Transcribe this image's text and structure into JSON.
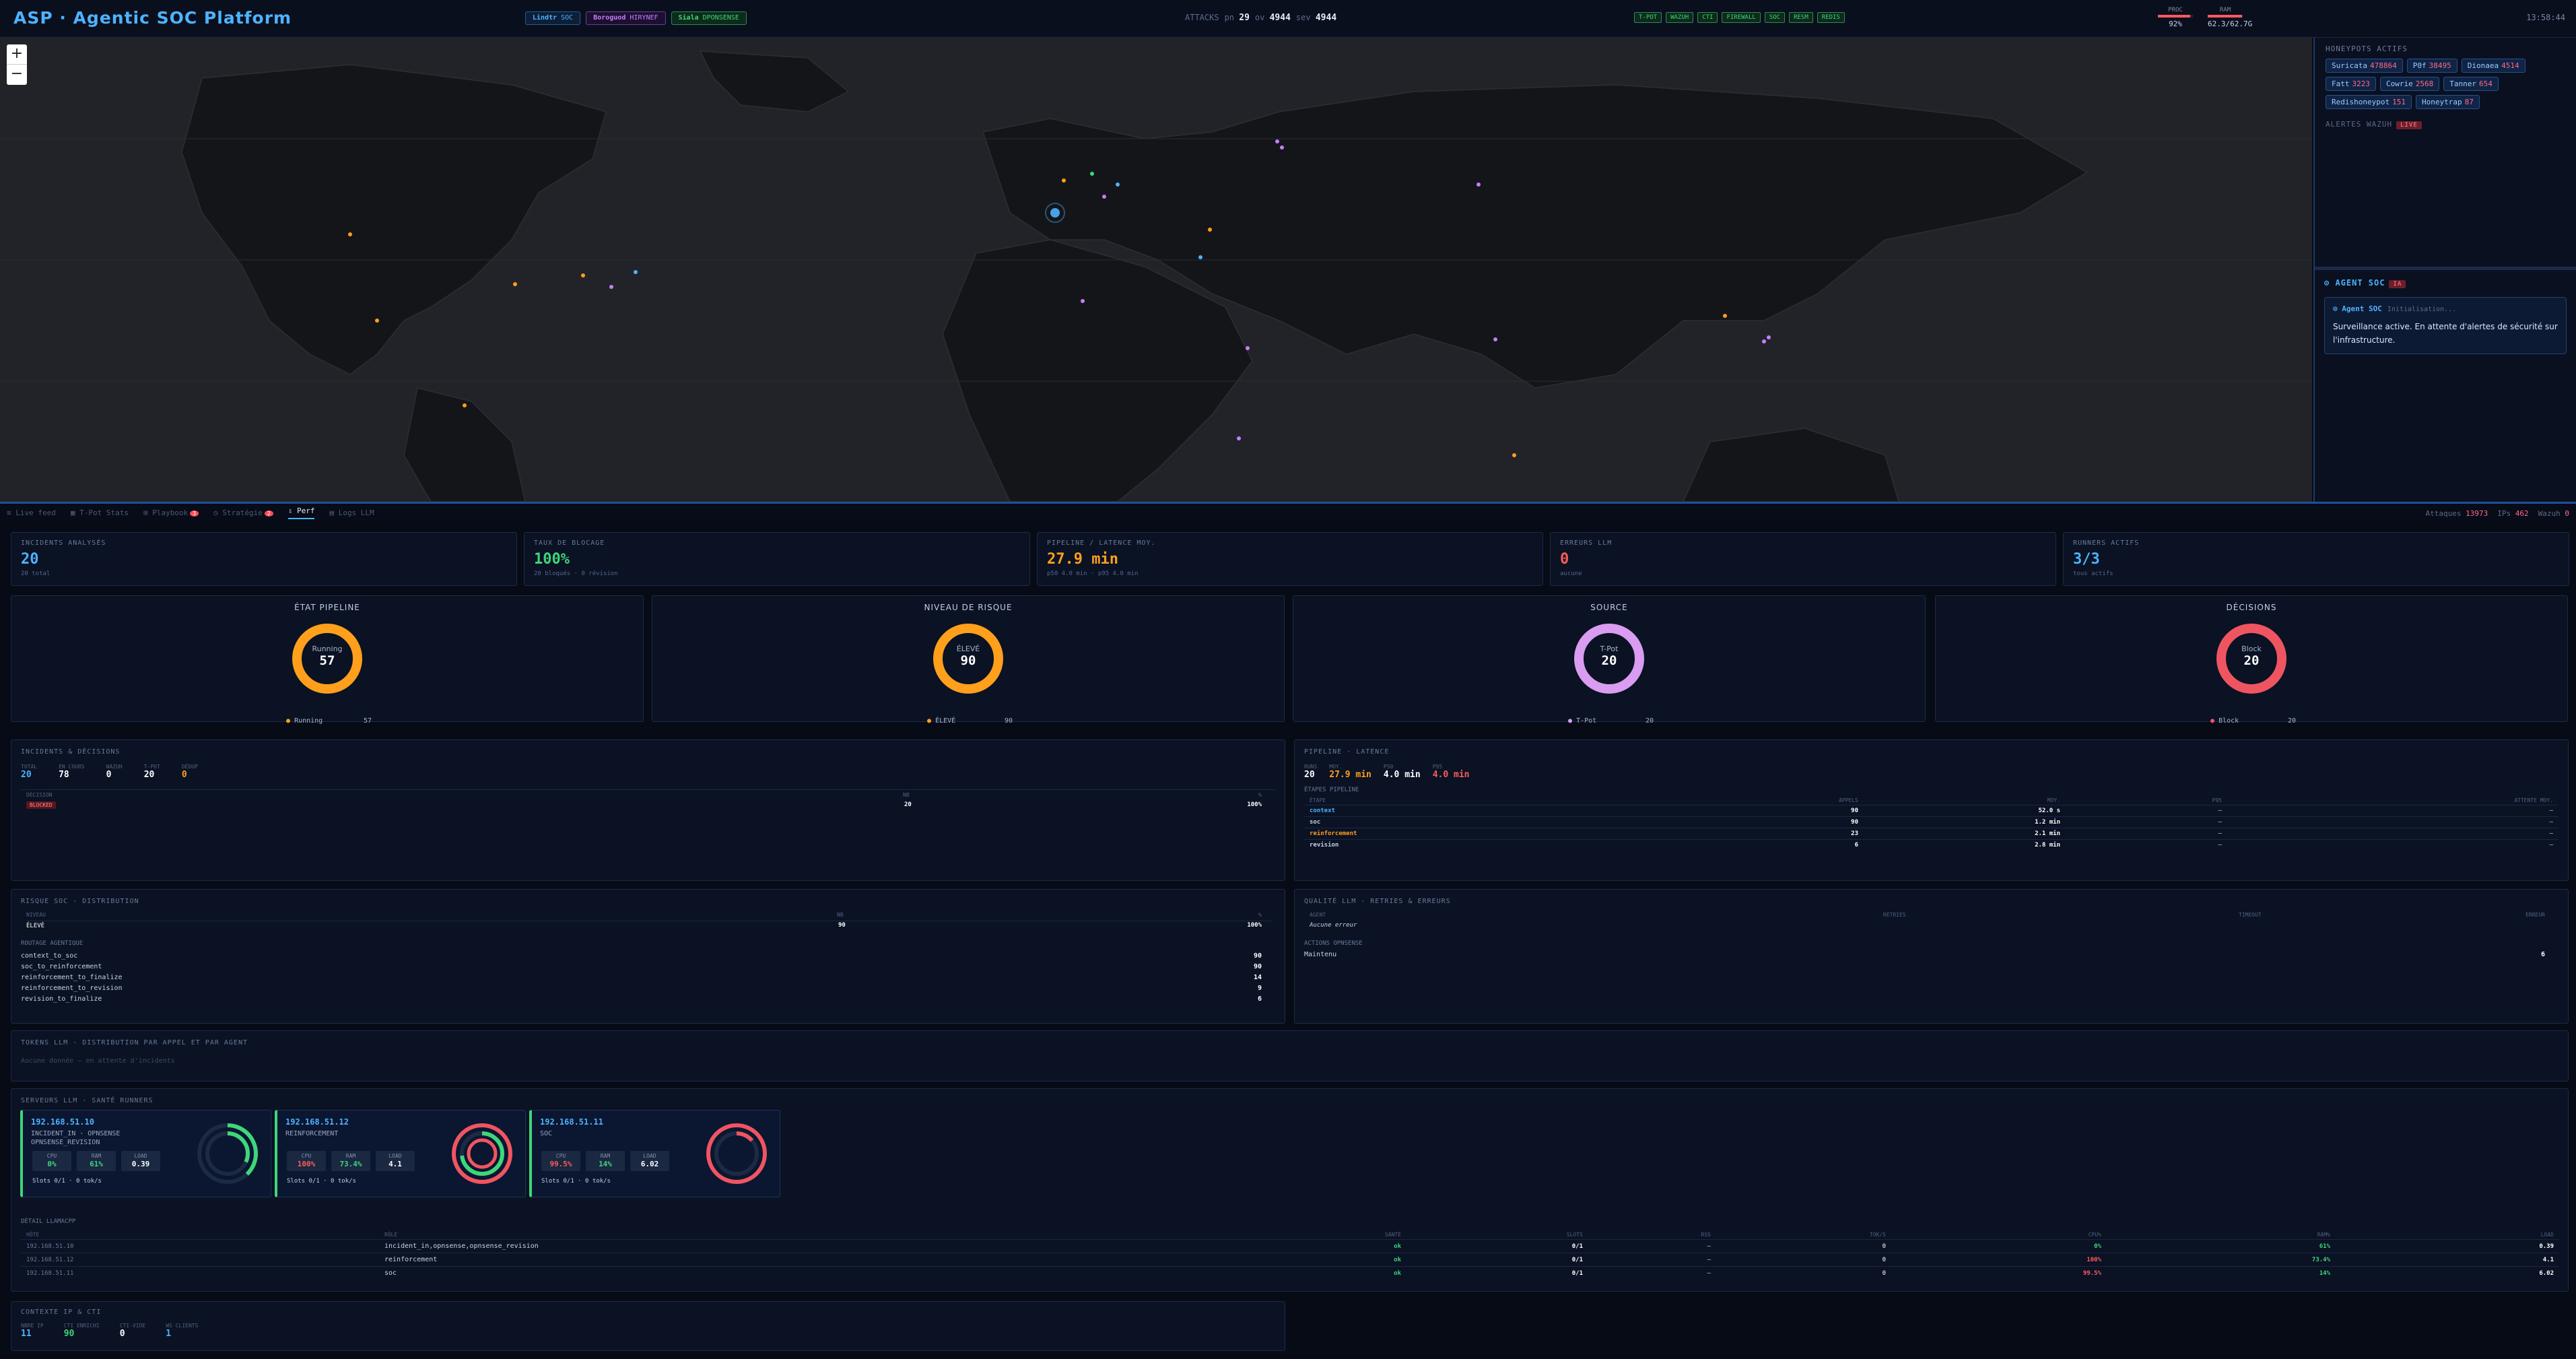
{
  "header": {
    "title": "ASP · Agentic SOC Platform",
    "pills": [
      {
        "label": "Lindtr",
        "value": "SOC",
        "color": "#4db3ff"
      },
      {
        "label": "Boroguod",
        "value": "HIRYNEF",
        "color": "#c77dff"
      },
      {
        "label": "Siala",
        "value": "DPONSENSE",
        "color": "#3fd67a"
      }
    ],
    "stats": {
      "attacks_label": "ATTACKS",
      "a_label": "pn",
      "a_value": "29",
      "b_label": "ov",
      "b_value": "4944",
      "c_label": "sev",
      "c_value": "4944"
    },
    "modules": [
      "T-POT",
      "WAZUH",
      "CTI",
      "FIREWALL",
      "SOC",
      "RESM",
      "REDIS"
    ],
    "meters": [
      {
        "label": "PROC",
        "value": "92%",
        "fill": 0.92
      },
      {
        "label": "RAM",
        "value": "62.3/62.7G",
        "fill": 0.99
      }
    ],
    "clock": "13:58:44"
  },
  "map": {
    "zoom_in": "+",
    "zoom_out": "−"
  },
  "right_panel": {
    "honeypots_title": "HONEYPOTS ACTIFS",
    "honeypots": [
      {
        "name": "Suricata",
        "count": "478864"
      },
      {
        "name": "P0f",
        "count": "38495"
      },
      {
        "name": "Dionaea",
        "count": "4514"
      },
      {
        "name": "Fatt",
        "count": "3223"
      },
      {
        "name": "Cowrie",
        "count": "2568"
      },
      {
        "name": "Tanner",
        "count": "654"
      },
      {
        "name": "Redishoneypot",
        "count": "151"
      },
      {
        "name": "Honeytrap",
        "count": "87"
      }
    ],
    "alerts_title": "ALERTES WAZUH",
    "alerts_badge": "LIVE",
    "agent_title": "⊙ AGENT SOC",
    "agent_badge": "IA",
    "agent_card_title": "⊙ Agent SOC",
    "agent_card_sub": "Initialisation...",
    "agent_message": "Surveillance active. En attente d'alertes de sécurité sur l'infrastructure."
  },
  "tabs": {
    "items": [
      {
        "label": "≡ Live feed",
        "active": false
      },
      {
        "label": "▦ T-Pot Stats",
        "active": false
      },
      {
        "label": "⊞ Playbook",
        "active": false,
        "badge": "3"
      },
      {
        "label": "◷ Stratégie",
        "active": false,
        "badge": "2"
      },
      {
        "label": "⇩ Perf",
        "active": true
      },
      {
        "label": "▤ Logs LLM",
        "active": false
      }
    ],
    "right": {
      "a_label": "Attaques",
      "a_value": "13973",
      "b_label": "IPs",
      "b_value": "462",
      "c_label": "Wazuh",
      "c_value": "0"
    }
  },
  "kpis": [
    {
      "label": "INCIDENTS ANALYSÉS",
      "value": "20",
      "sub": "20 total",
      "color": "#4db3ff"
    },
    {
      "label": "TAUX DE BLOCAGE",
      "value": "100%",
      "sub": "20 bloqués · 0 révision",
      "color": "#3fd67a"
    },
    {
      "label": "PIPELINE / LATENCE MOY.",
      "value": "27.9 min",
      "sub": "p50 4.0 min · p95 4.0 min",
      "color": "#ff9f1c"
    },
    {
      "label": "ERREURS LLM",
      "value": "0",
      "sub": "aucune",
      "color": "#ff5b5b"
    },
    {
      "label": "RUNNERS ACTIFS",
      "value": "3/3",
      "sub": "tous actifs",
      "color": "#4db3ff"
    }
  ],
  "donuts": [
    {
      "title": "ÉTAT PIPELINE",
      "name": "Running",
      "value": "57",
      "color": "#ff9f1c",
      "legend": "Running"
    },
    {
      "title": "NIVEAU DE RISQUE",
      "name": "ÉLEVÉ",
      "value": "90",
      "color": "#ff9f1c",
      "legend": "ÉLEVÉ"
    },
    {
      "title": "SOURCE",
      "name": "T-Pot",
      "value": "20",
      "color": "#d99cf0",
      "legend": "T-Pot"
    },
    {
      "title": "DÉCISIONS",
      "name": "Block",
      "value": "20",
      "color": "#ef5561",
      "legend": "Block"
    }
  ],
  "incidents": {
    "title": "INCIDENTS & DÉCISIONS",
    "stats": [
      {
        "label": "TOTAL",
        "value": "20",
        "color": "#4db3ff"
      },
      {
        "label": "EN COURS",
        "value": "78",
        "color": "#ffffff"
      },
      {
        "label": "WAZUH",
        "value": "0",
        "color": "#ffffff"
      },
      {
        "label": "T-POT",
        "value": "20",
        "color": "#ffffff"
      },
      {
        "label": "DÉDUP",
        "value": "0",
        "color": "#ff9f1c"
      }
    ],
    "headers": [
      "DÉCISION",
      "NB",
      "%"
    ],
    "rows": [
      {
        "decision": "BLOCKED",
        "nb": "20",
        "pct": "100%"
      }
    ]
  },
  "pipeline": {
    "title": "PIPELINE · LATENCE",
    "stats": [
      {
        "label": "RUNS",
        "value": "20",
        "color": "#ffffff"
      },
      {
        "label": "MOY.",
        "value": "27.9 min",
        "color": "#ff9f1c"
      },
      {
        "label": "P50",
        "value": "4.0 min",
        "color": "#ffffff"
      },
      {
        "label": "P95",
        "value": "4.0 min",
        "color": "#ff5b5b"
      }
    ],
    "stages_title": "ÉTAPES PIPELINE",
    "headers": [
      "ÉTAPE",
      "APPELS",
      "MOY.",
      "P95",
      "ATTENTE MOY."
    ],
    "rows": [
      {
        "stage": "context",
        "calls": "90",
        "avg": "52.0 s",
        "p95": "—",
        "wait": "—",
        "color": "#4db3ff"
      },
      {
        "stage": "soc",
        "calls": "90",
        "avg": "1.2 min",
        "p95": "—",
        "wait": "—",
        "color": "#c9d4e8"
      },
      {
        "stage": "reinforcement",
        "calls": "23",
        "avg": "2.1 min",
        "p95": "—",
        "wait": "—",
        "color": "#ff9f1c"
      },
      {
        "stage": "revision",
        "calls": "6",
        "avg": "2.8 min",
        "p95": "—",
        "wait": "—",
        "color": "#c9d4e8"
      }
    ]
  },
  "risk": {
    "title": "RISQUE SOC · DISTRIBUTION",
    "headers": [
      "NIVEAU",
      "NB",
      "%"
    ],
    "rows": [
      {
        "level": "ÉLEVÉ",
        "nb": "90",
        "pct": "100%"
      }
    ],
    "routing_title": "ROUTAGE AGENTIQUE",
    "routing": [
      {
        "route": "context_to_soc",
        "n": "90"
      },
      {
        "route": "soc_to_reinforcement",
        "n": "90"
      },
      {
        "route": "reinforcement_to_finalize",
        "n": "14"
      },
      {
        "route": "reinforcement_to_revision",
        "n": "9"
      },
      {
        "route": "revision_to_finalize",
        "n": "6"
      }
    ]
  },
  "quality": {
    "title": "QUALITÉ LLM · RETRIES & ERREURS",
    "headers": [
      "AGENT",
      "RETRIES",
      "TIMEOUT",
      "ERREUR"
    ],
    "empty": "Aucune erreur",
    "actions_title": "ACTIONS OPNSENSE",
    "actions": [
      {
        "name": "Maintenu",
        "n": "6"
      }
    ]
  },
  "tokens": {
    "title": "TOKENS LLM · DISTRIBUTION PAR APPEL ET PAR AGENT",
    "empty": "Aucune donnée — en attente d'incidents"
  },
  "servers": {
    "title": "SERVEURS LLM · SANTÉ RUNNERS",
    "items": [
      {
        "ip": "192.168.51.10",
        "role1": "INCIDENT_IN · OPNSENSE",
        "role2": "OPNSENSE_REVISION",
        "cpu": "0%",
        "ram": "61%",
        "load": "0.39",
        "slots": "Slots 0/1 · 0 tok/s",
        "c1": "#3fd67a",
        "c2": "#3fd67a",
        "ring": "#3fd67a",
        "ring2": "#3fd67a"
      },
      {
        "ip": "192.168.51.12",
        "role1": "REINFORCEMENT",
        "role2": "",
        "cpu": "100%",
        "ram": "73.4%",
        "load": "4.1",
        "slots": "Slots 0/1 · 0 tok/s",
        "c1": "#ff5b5b",
        "c2": "#3fd67a",
        "ring": "#ef5561",
        "ring2": "#3fd67a"
      },
      {
        "ip": "192.168.51.11",
        "role1": "SOC",
        "role2": "",
        "cpu": "99.5%",
        "ram": "14%",
        "load": "6.02",
        "slots": "Slots 0/1 · 0 tok/s",
        "c1": "#ff5b5b",
        "c2": "#3fd67a",
        "ring": "#ef5561",
        "ring2": "#ef5561"
      }
    ],
    "table_title": "DÉTAIL LLAMACPP",
    "headers": [
      "HÔTE",
      "RÔLE",
      "SANTÉ",
      "SLOTS",
      "RSS",
      "TOK/S",
      "CPU%",
      "RAM%",
      "LOAD"
    ],
    "rows": [
      {
        "host": "192.168.51.10",
        "role": "incident_in,opnsense,opnsense_revision",
        "health": "ok",
        "slots": "0/1",
        "rss": "—",
        "toks": "0",
        "cpu": "0%",
        "ram": "61%",
        "load": "0.39",
        "cpu_c": "#3fd67a"
      },
      {
        "host": "192.168.51.12",
        "role": "reinforcement",
        "health": "ok",
        "slots": "0/1",
        "rss": "—",
        "toks": "0",
        "cpu": "100%",
        "ram": "73.4%",
        "load": "4.1",
        "cpu_c": "#ff5b5b"
      },
      {
        "host": "192.168.51.11",
        "role": "soc",
        "health": "ok",
        "slots": "0/1",
        "rss": "—",
        "toks": "0",
        "cpu": "99.5%",
        "ram": "14%",
        "load": "6.02",
        "cpu_c": "#ff5b5b"
      }
    ]
  },
  "context": {
    "title": "CONTEXTE IP & CTI",
    "stats": [
      {
        "label": "NBRE IP",
        "value": "11",
        "color": "#4db3ff"
      },
      {
        "label": "CTI ENRICHI",
        "value": "90",
        "color": "#3fd67a"
      },
      {
        "label": "CTI-VIDE",
        "value": "0",
        "color": "#ffffff"
      },
      {
        "label": "WS CLIENTS",
        "value": "1",
        "color": "#4db3ff"
      }
    ]
  },
  "colors": {
    "accent": "#4db3ff",
    "ok": "#3fd67a",
    "warn": "#ff9f1c",
    "danger": "#ff5b5b"
  }
}
